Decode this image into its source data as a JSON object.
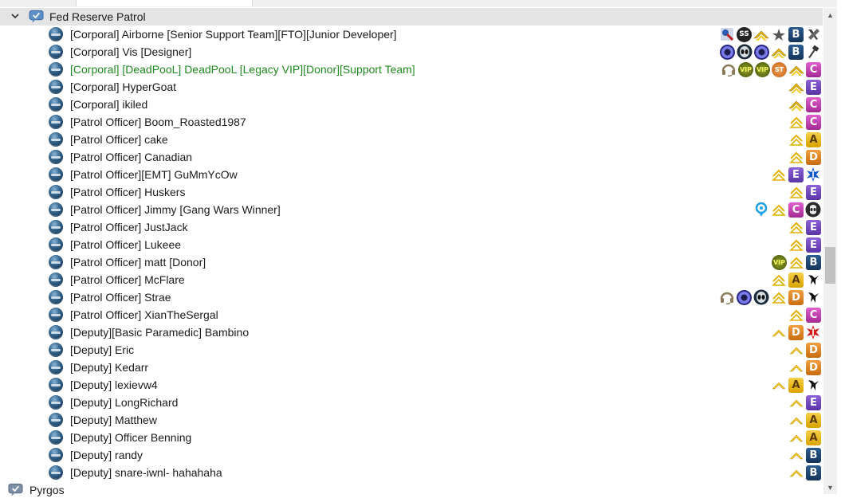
{
  "channel": {
    "name": "Fed Reserve Patrol",
    "expanded": true
  },
  "next_channel": {
    "name": "Pyrgos"
  },
  "users": [
    {
      "name": "[Corporal] Airborne [Senior Support Team][FTO][Junior Developer]",
      "green": false,
      "badges": [
        "wrench-hammer-icon",
        "rank-B",
        "star-icon",
        "chevron-gold",
        "ss-badge",
        "support-team-icon"
      ]
    },
    {
      "name": "[Corporal] Vis [Designer]",
      "green": false,
      "badges": [
        "hammer-icon",
        "rank-B",
        "chevron-gold",
        "ring-badge",
        "alien-badge",
        "ring-badge"
      ]
    },
    {
      "name": "[Corporal] [DeadPooL] DeadPooL [Legacy VIP][Donor][Support Team]",
      "green": true,
      "badges": [
        "rank-C",
        "chevron-gold",
        "st-badge",
        "vip-badge",
        "vip-badge",
        "headset-icon"
      ]
    },
    {
      "name": "[Corporal] HyperGoat",
      "green": false,
      "badges": [
        "rank-E",
        "chevron-gold"
      ]
    },
    {
      "name": "[Corporal] ikiled",
      "green": false,
      "badges": [
        "rank-C",
        "chevron-gold"
      ]
    },
    {
      "name": "[Patrol Officer] Boom_Roasted1987",
      "green": false,
      "badges": [
        "rank-C",
        "chevron-outline"
      ]
    },
    {
      "name": "[Patrol Officer] cake",
      "green": false,
      "badges": [
        "rank-A",
        "chevron-outline"
      ]
    },
    {
      "name": "[Patrol Officer] Canadian",
      "green": false,
      "badges": [
        "rank-D",
        "chevron-outline"
      ]
    },
    {
      "name": "[Patrol Officer][EMT] GuMmYcOw",
      "green": false,
      "badges": [
        "medic-icon",
        "rank-E",
        "chevron-outline"
      ]
    },
    {
      "name": "[Patrol Officer] Huskers",
      "green": false,
      "badges": [
        "rank-E",
        "chevron-outline"
      ]
    },
    {
      "name": "[Patrol Officer] Jimmy [Gang Wars Winner]",
      "green": false,
      "badges": [
        "mask-badge",
        "rank-C",
        "chevron-outline",
        "pin-icon"
      ]
    },
    {
      "name": "[Patrol Officer] JustJack",
      "green": false,
      "badges": [
        "rank-E",
        "chevron-outline"
      ]
    },
    {
      "name": "[Patrol Officer] Lukeee",
      "green": false,
      "badges": [
        "rank-E",
        "chevron-outline"
      ]
    },
    {
      "name": "[Patrol Officer] matt [Donor]",
      "green": false,
      "badges": [
        "rank-B",
        "chevron-outline",
        "vip-badge"
      ]
    },
    {
      "name": "[Patrol Officer] McFlare",
      "green": false,
      "badges": [
        "wolf-icon",
        "rank-A",
        "chevron-outline"
      ]
    },
    {
      "name": "[Patrol Officer] Strae",
      "green": false,
      "badges": [
        "wolf-icon",
        "rank-D",
        "chevron-outline",
        "alien-badge",
        "ring-badge",
        "headset-icon"
      ]
    },
    {
      "name": "[Patrol Officer] XianTheSergal",
      "green": false,
      "badges": [
        "rank-C",
        "chevron-outline"
      ]
    },
    {
      "name": "[Deputy][Basic Paramedic] Bambino",
      "green": false,
      "badges": [
        "paramedic-icon",
        "rank-D",
        "chevron-thin"
      ]
    },
    {
      "name": "[Deputy] Eric",
      "green": false,
      "badges": [
        "rank-D",
        "chevron-thin"
      ]
    },
    {
      "name": "[Deputy] Kedarr",
      "green": false,
      "badges": [
        "rank-D",
        "chevron-thin"
      ]
    },
    {
      "name": "[Deputy] lexievw4",
      "green": false,
      "badges": [
        "wolf-icon",
        "rank-A",
        "chevron-thin"
      ]
    },
    {
      "name": "[Deputy] LongRichard",
      "green": false,
      "badges": [
        "rank-E",
        "chevron-thin"
      ]
    },
    {
      "name": "[Deputy] Matthew",
      "green": false,
      "badges": [
        "rank-A",
        "chevron-thin"
      ]
    },
    {
      "name": "[Deputy] Officer Benning",
      "green": false,
      "badges": [
        "rank-A",
        "chevron-thin"
      ]
    },
    {
      "name": "[Deputy] randy",
      "green": false,
      "badges": [
        "rank-B",
        "chevron-thin"
      ]
    },
    {
      "name": "[Deputy] snare-iwnl- hahahaha",
      "green": false,
      "badges": [
        "rank-B",
        "chevron-thin"
      ]
    }
  ],
  "rank_letters": {
    "rank-A": "A",
    "rank-B": "B",
    "rank-C": "C",
    "rank-D": "D",
    "rank-E": "E"
  },
  "badge_text": {
    "ss-badge": "SS",
    "vip-badge": "VIP",
    "st-badge": "ST"
  },
  "scrollbar": {
    "up_glyph": "▲",
    "down_glyph": "▼"
  }
}
